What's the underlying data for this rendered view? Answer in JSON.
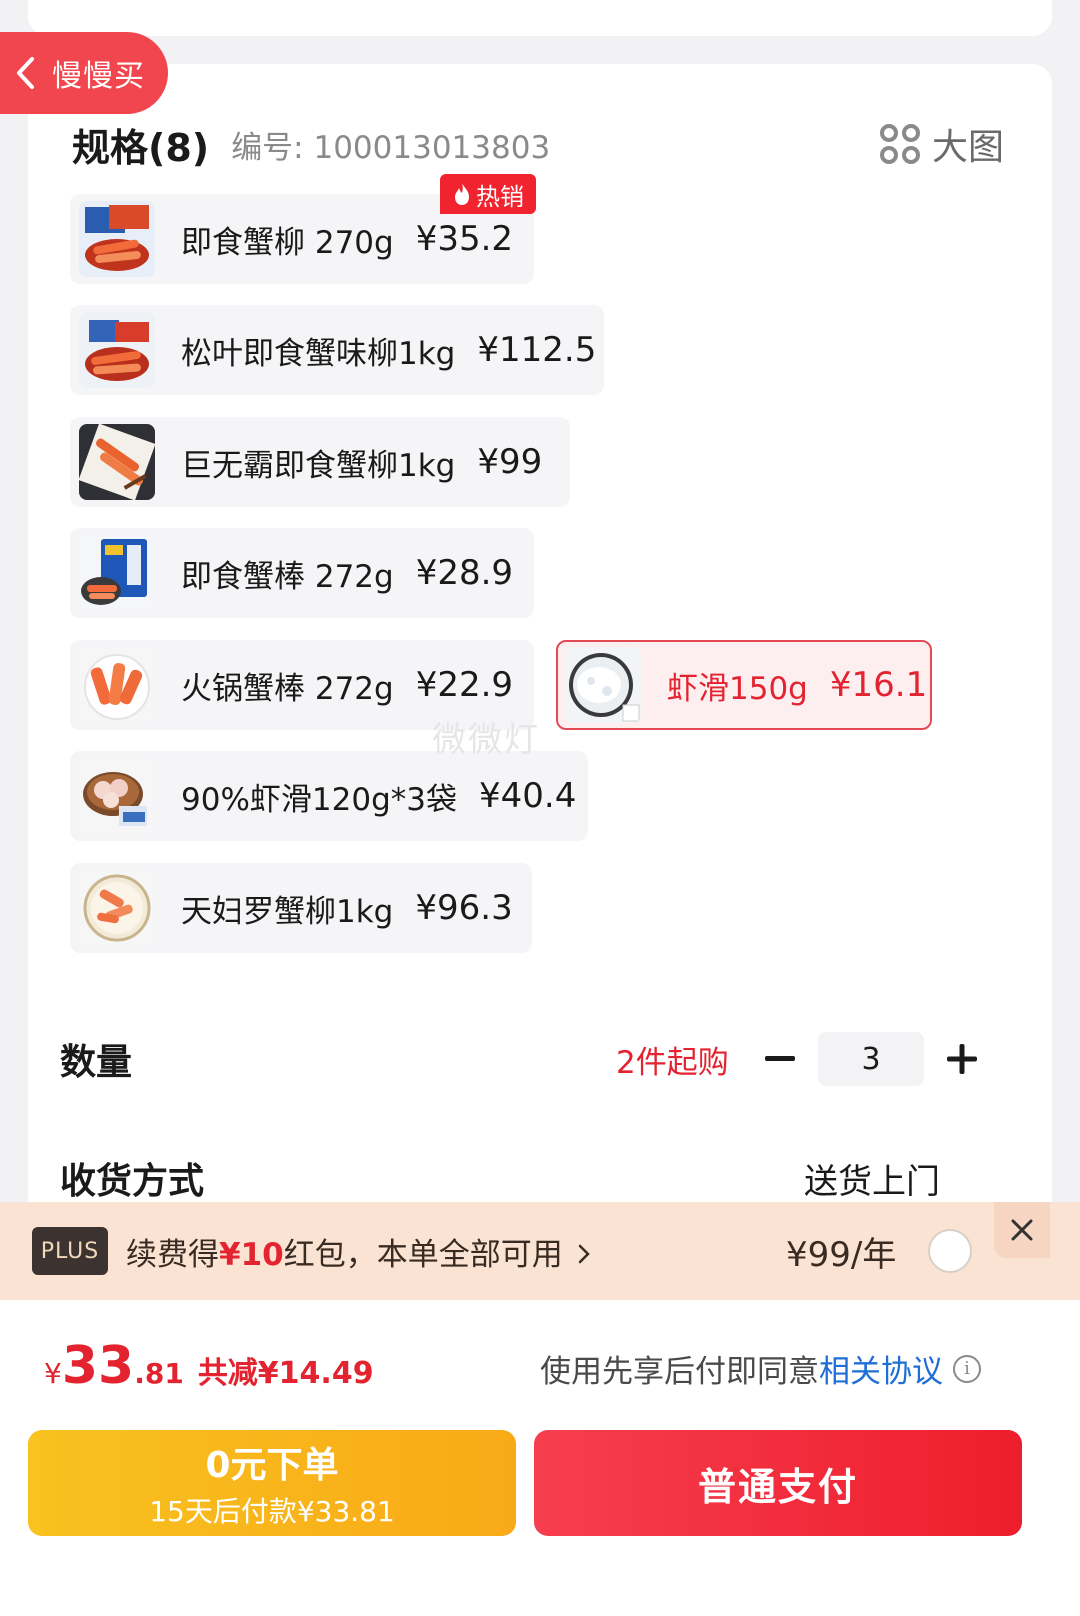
{
  "nav": {
    "back_label": "慢慢买"
  },
  "spec": {
    "title": "规格(8)",
    "code": "编号: 100013013803",
    "big_picture_label": "大图",
    "hot_badge": "热销",
    "options": [
      {
        "label": "即食蟹柳 270g",
        "price": "¥35.2",
        "selected": false,
        "hot": true
      },
      {
        "label": "松叶即食蟹味柳1kg",
        "price": "¥112.5",
        "selected": false
      },
      {
        "label": "巨无霸即食蟹柳1kg",
        "price": "¥99",
        "selected": false
      },
      {
        "label": "即食蟹棒 272g",
        "price": "¥28.9",
        "selected": false
      },
      {
        "label": "火锅蟹棒 272g",
        "price": "¥22.9",
        "selected": false
      },
      {
        "label": "虾滑150g",
        "price": "¥16.1",
        "selected": true
      },
      {
        "label": "90%虾滑120g*3袋",
        "price": "¥40.4",
        "selected": false
      },
      {
        "label": "天妇罗蟹柳1kg",
        "price": "¥96.3",
        "selected": false
      }
    ]
  },
  "watermark": "微微灯",
  "quantity": {
    "title": "数量",
    "min_purchase": "2件起购",
    "value": "3"
  },
  "delivery": {
    "title": "收货方式",
    "value": "送货上门"
  },
  "plus": {
    "badge": "PLUS",
    "text_before": "续费得",
    "text_highlight": "¥10",
    "text_after": "红包，本单全部可用",
    "price": "¥99/年"
  },
  "summary": {
    "yen": "¥",
    "total_int": "33",
    "total_dec": ".81",
    "saved": "共减¥14.49",
    "agree_text": "使用先享后付即同意",
    "agree_link": "相关协议"
  },
  "buttons": {
    "later_main": "0元下单",
    "later_sub": "15天后付款¥33.81",
    "pay": "普通支付"
  },
  "colors": {
    "accent_red": "#e3232f",
    "pay_button": "#f23a4b",
    "later_button": "#f8b81b",
    "link_blue": "#1f6fd6"
  }
}
